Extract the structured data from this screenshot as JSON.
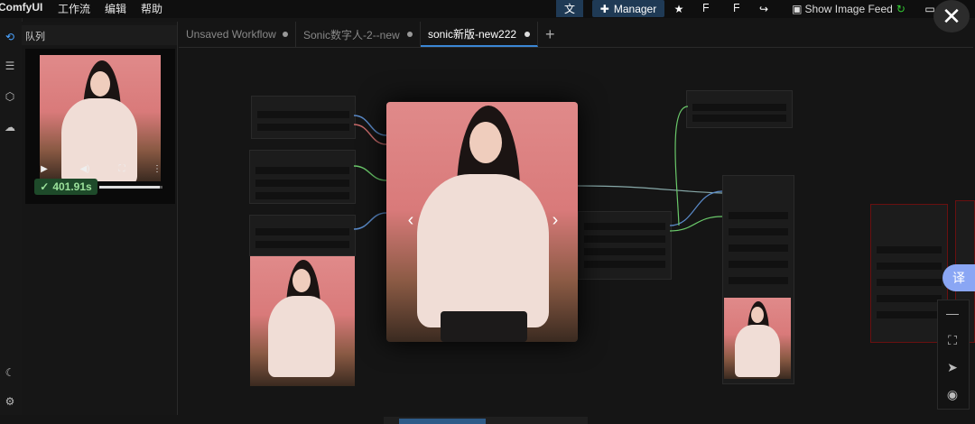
{
  "app": {
    "title": "ComfyUI"
  },
  "menu": {
    "items": [
      "工作流",
      "编辑",
      "帮助"
    ]
  },
  "toolbar": {
    "translate_icon": "translate-icon",
    "manager_label": "Manager",
    "show_image_feed_label": "Show Image Feed",
    "accent": "#1f3a55"
  },
  "queue": {
    "title": "队列",
    "timer": "401.91s",
    "progress": 0.95
  },
  "tabs": [
    {
      "label": "Unsaved Workflow"
    },
    {
      "label": "Sonic数字人-2--new"
    },
    {
      "label": "sonic新版-new222"
    }
  ],
  "side_badge": {
    "label": "译"
  },
  "canvas_tools": [
    "minus-icon",
    "fit-view-icon",
    "navigate-icon",
    "eye-icon"
  ]
}
